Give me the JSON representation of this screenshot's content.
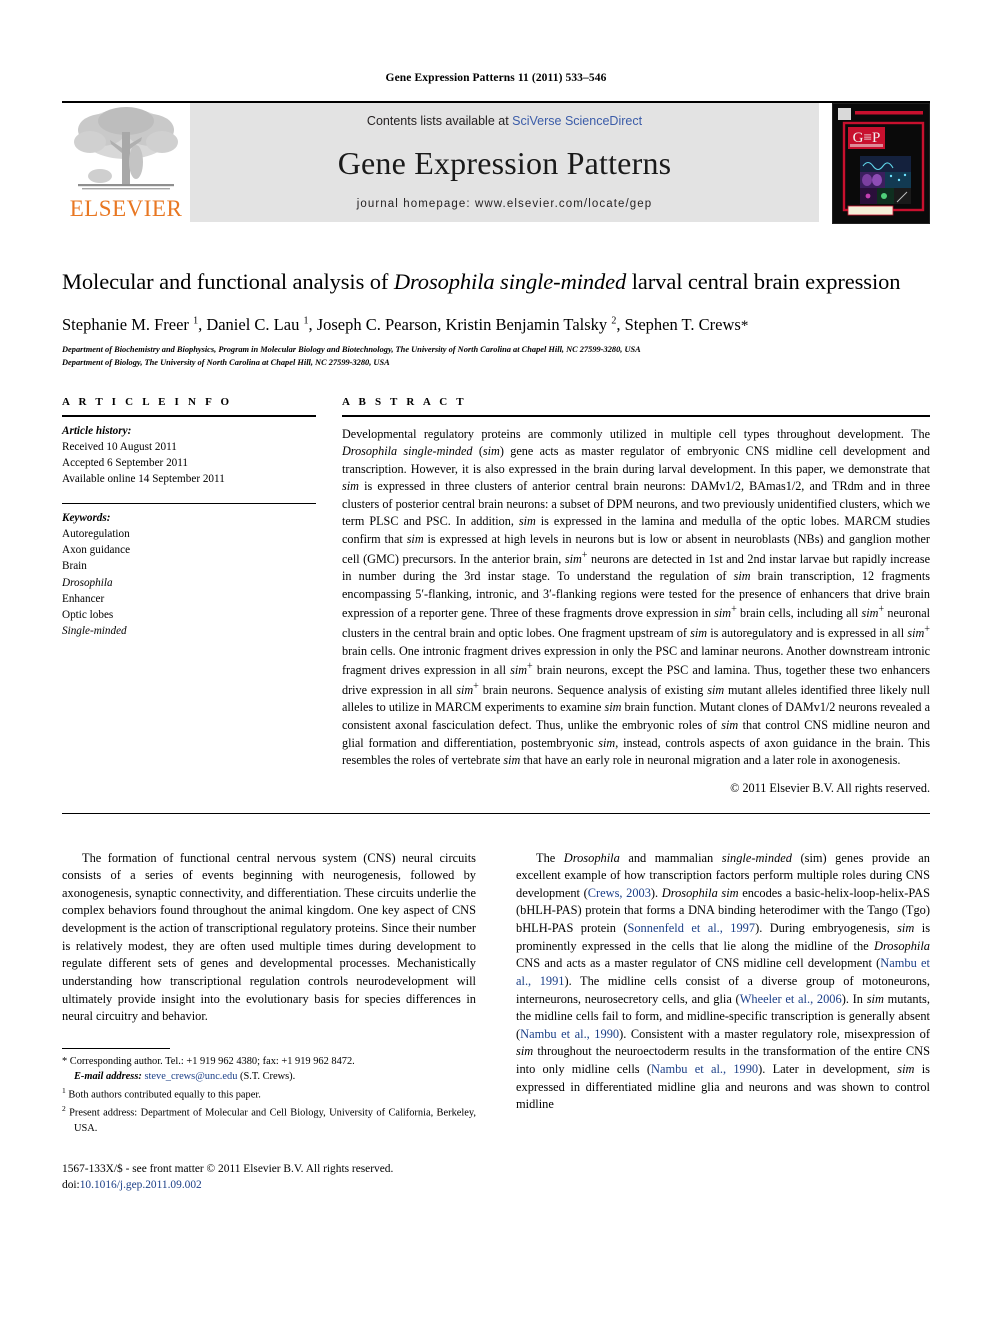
{
  "running_head": "Gene Expression Patterns 11 (2011) 533–546",
  "masthead": {
    "contents_prefix": "Contents lists available at ",
    "contents_link": "SciVerse ScienceDirect",
    "journal_name": "Gene Expression Patterns",
    "homepage": "journal homepage: www.elsevier.com/locate/gep",
    "publisher_wordmark": "ELSEVIER",
    "publisher_color": "#E87722",
    "link_color": "#3b5ca8",
    "band_color": "#e3e3e3",
    "cover": {
      "logo_text": "GEP",
      "accent_color": "#c8102e",
      "background_color": "#0a0a0a"
    }
  },
  "title": {
    "part1": "Molecular and functional analysis of ",
    "italic1": "Drosophila single-minded",
    "part2": " larval central brain expression"
  },
  "authors": {
    "list": [
      {
        "name": "Stephanie M. Freer",
        "sup": "1"
      },
      {
        "name": "Daniel C. Lau",
        "sup": "1"
      },
      {
        "name": "Joseph C. Pearson",
        "sup": ""
      },
      {
        "name": "Kristin Benjamin Talsky",
        "sup": "2"
      },
      {
        "name": "Stephen T. Crews",
        "sup": "*"
      }
    ],
    "line": "Stephanie M. Freer 1, Daniel C. Lau 1, Joseph C. Pearson, Kristin Benjamin Talsky 2, Stephen T. Crews*"
  },
  "affiliations": [
    "Department of Biochemistry and Biophysics, Program in Molecular Biology and Biotechnology, The University of North Carolina at Chapel Hill, NC 27599-3280, USA",
    "Department of Biology, The University of North Carolina at Chapel Hill, NC 27599-3280, USA"
  ],
  "article_info": {
    "heading": "A R T I C L E   I N F O",
    "history_label": "Article history:",
    "history": [
      "Received 10 August 2011",
      "Accepted 6 September 2011",
      "Available online 14 September 2011"
    ],
    "keywords_label": "Keywords:",
    "keywords": [
      {
        "text": "Autoregulation",
        "italic": false
      },
      {
        "text": "Axon guidance",
        "italic": false
      },
      {
        "text": "Brain",
        "italic": false
      },
      {
        "text": "Drosophila",
        "italic": true
      },
      {
        "text": "Enhancer",
        "italic": false
      },
      {
        "text": "Optic lobes",
        "italic": false
      },
      {
        "text": "Single-minded",
        "italic": true
      }
    ]
  },
  "abstract": {
    "heading": "A B S T R A C T",
    "text": "Developmental regulatory proteins are commonly utilized in multiple cell types throughout development. The Drosophila single-minded (sim) gene acts as master regulator of embryonic CNS midline cell development and transcription. However, it is also expressed in the brain during larval development. In this paper, we demonstrate that sim is expressed in three clusters of anterior central brain neurons: DAMv1/2, BAmas1/2, and TRdm and in three clusters of posterior central brain neurons: a subset of DPM neurons, and two previously unidentified clusters, which we term PLSC and PSC. In addition, sim is expressed in the lamina and medulla of the optic lobes. MARCM studies confirm that sim is expressed at high levels in neurons but is low or absent in neuroblasts (NBs) and ganglion mother cell (GMC) precursors. In the anterior brain, sim+ neurons are detected in 1st and 2nd instar larvae but rapidly increase in number during the 3rd instar stage. To understand the regulation of sim brain transcription, 12 fragments encompassing 5′-flanking, intronic, and 3′-flanking regions were tested for the presence of enhancers that drive brain expression of a reporter gene. Three of these fragments drove expression in sim+ brain cells, including all sim+ neuronal clusters in the central brain and optic lobes. One fragment upstream of sim is autoregulatory and is expressed in all sim+ brain cells. One intronic fragment drives expression in only the PSC and laminar neurons. Another downstream intronic fragment drives expression in all sim+ brain neurons, except the PSC and lamina. Thus, together these two enhancers drive expression in all sim+ brain neurons. Sequence analysis of existing sim mutant alleles identified three likely null alleles to utilize in MARCM experiments to examine sim brain function. Mutant clones of DAMv1/2 neurons revealed a consistent axonal fasciculation defect. Thus, unlike the embryonic roles of sim that control CNS midline neuron and glial formation and differentiation, postembryonic sim, instead, controls aspects of axon guidance in the brain. This resembles the roles of vertebrate sim that have an early role in neuronal migration and a later role in axonogenesis.",
    "copyright": "© 2011 Elsevier B.V. All rights reserved."
  },
  "body": {
    "left_paragraph": "The formation of functional central nervous system (CNS) neural circuits consists of a series of events beginning with neurogenesis, followed by axonogenesis, synaptic connectivity, and differentiation. These circuits underlie the complex behaviors found throughout the animal kingdom. One key aspect of CNS development is the action of transcriptional regulatory proteins. Since their number is relatively modest, they are often used multiple times during development to regulate different sets of genes and developmental processes. Mechanistically understanding how transcriptional regulation controls neurodevelopment will ultimately provide insight into the evolutionary basis for species differences in neural circuitry and behavior.",
    "right_paragraph": "The Drosophila and mammalian single-minded (sim) genes provide an excellent example of how transcription factors perform multiple roles during CNS development (Crews, 2003). Drosophila sim encodes a basic-helix-loop-helix-PAS (bHLH-PAS) protein that forms a DNA binding heterodimer with the Tango (Tgo) bHLH-PAS protein (Sonnenfeld et al., 1997). During embryogenesis, sim is prominently expressed in the cells that lie along the midline of the Drosophila CNS and acts as a master regulator of CNS midline cell development (Nambu et al., 1991). The midline cells consist of a diverse group of motoneurons, interneurons, neurosecretory cells, and glia (Wheeler et al., 2006). In sim mutants, the midline cells fail to form, and midline-specific transcription is generally absent (Nambu et al., 1990). Consistent with a master regulatory role, misexpression of sim throughout the neuroectoderm results in the transformation of the entire CNS into only midline cells (Nambu et al., 1990). Later in development, sim is expressed in differentiated midline glia and neurons and was shown to control midline"
  },
  "footnotes": {
    "corresponding": "* Corresponding author. Tel.: +1 919 962 4380; fax: +1 919 962 8472.",
    "email_label": "E-mail address:",
    "email": "steve_crews@unc.edu",
    "email_suffix": " (S.T. Crews).",
    "note1": "Both authors contributed equally to this paper.",
    "note2": "Present address: Department of Molecular and Cell Biology, University of California, Berkeley, USA.",
    "issn_line": "1567-133X/$ - see front matter © 2011 Elsevier B.V. All rights reserved.",
    "doi_label": "doi:",
    "doi": "10.1016/j.gep.2011.09.002",
    "link_color": "#1b3f87"
  }
}
